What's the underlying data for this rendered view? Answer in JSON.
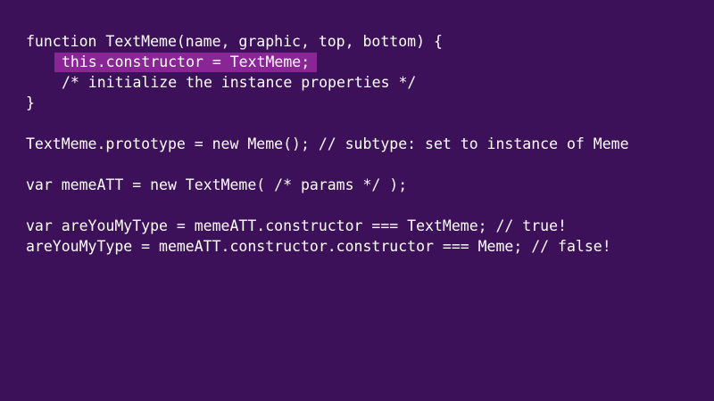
{
  "slide": {
    "background_color": "#3d1159",
    "highlight_color": "#8a2596",
    "text_color": "#ffffff"
  },
  "code_lines": [
    "function TextMeme(name, graphic, top, bottom) {",
    "this.constructor = TextMeme;",
    "/* initialize the instance properties */",
    "}",
    "TextMeme.prototype = new Meme(); // subtype: set to instance of Meme",
    "var memeATT = new TextMeme( /* params */ );",
    "var areYouMyType = memeATT.constructor === TextMeme; // true!",
    "areYouMyType = memeATT.constructor.constructor === Meme; // false!"
  ]
}
